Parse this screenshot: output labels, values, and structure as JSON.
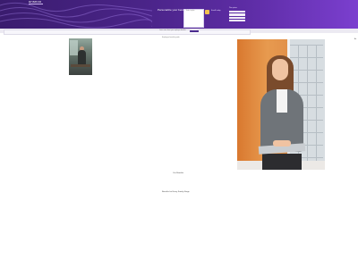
{
  "header": {
    "logo_text": "unsnoo",
    "title": "Personalize your benefit",
    "card_label": "Select a plan",
    "mini_text": "Enroll today",
    "panel_label": "Plan options"
  },
  "subband": {
    "text": "Learn more about your employee benefits",
    "button_label": "Continue"
  },
  "content": {
    "caption_top": "Employee benefits guide",
    "side_label": "Ac",
    "mid_text": "Our Benefits",
    "bottom_text": "Benefits for Every Family Stage"
  },
  "colors": {
    "header_start": "#3a1c6e",
    "header_end": "#7b3fcf",
    "accent": "#4b2b8f",
    "photo_wall": "#e0893f"
  }
}
